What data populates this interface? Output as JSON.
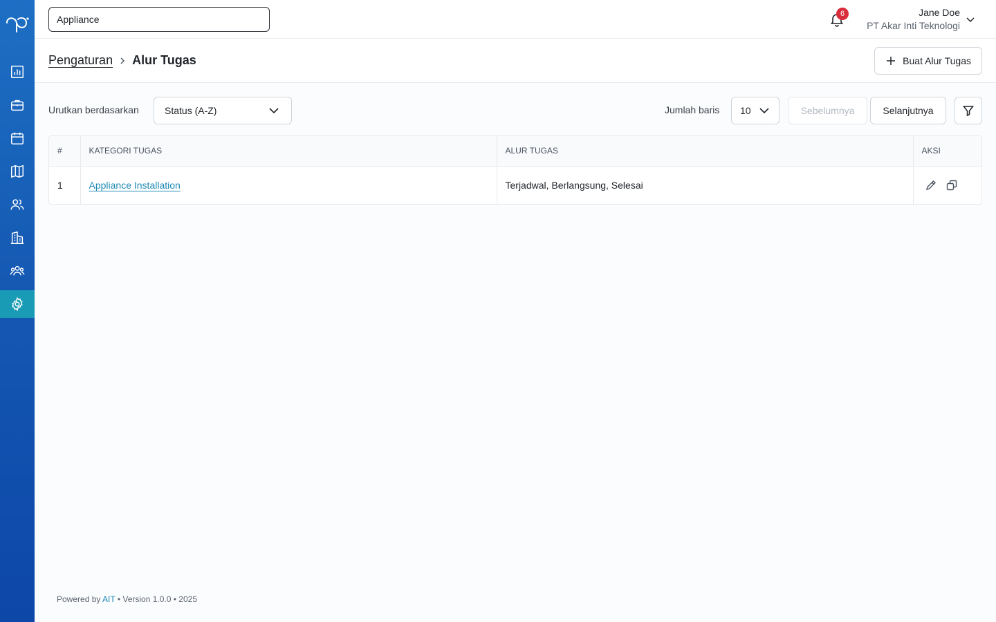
{
  "search": {
    "value": "Appliance"
  },
  "sidebar": {
    "items": [
      {
        "icon": "chart-bar-icon",
        "name": "sidebar-item-dashboard",
        "active": false
      },
      {
        "icon": "briefcase-icon",
        "name": "sidebar-item-jobs",
        "active": false
      },
      {
        "icon": "calendar-icon",
        "name": "sidebar-item-schedule",
        "active": false
      },
      {
        "icon": "map-icon",
        "name": "sidebar-item-map",
        "active": false
      },
      {
        "icon": "users-icon",
        "name": "sidebar-item-users",
        "active": false
      },
      {
        "icon": "building-icon",
        "name": "sidebar-item-companies",
        "active": false
      },
      {
        "icon": "team-icon",
        "name": "sidebar-item-teams",
        "active": false
      },
      {
        "icon": "gear-icon",
        "name": "sidebar-item-settings",
        "active": true
      }
    ]
  },
  "header": {
    "notification_count": "6",
    "user_name": "Jane Doe",
    "user_org": "PT Akar Inti Teknologi"
  },
  "breadcrumb": {
    "parent": "Pengaturan",
    "current": "Alur Tugas"
  },
  "actions": {
    "create_label": "Buat Alur Tugas"
  },
  "toolbar": {
    "sort_label": "Urutkan berdasarkan",
    "sort_value": "Status (A-Z)",
    "rows_label": "Jumlah baris",
    "rows_value": "10",
    "prev_label": "Sebelumnya",
    "next_label": "Selanjutnya"
  },
  "table": {
    "columns": [
      "#",
      "KATEGORI TUGAS",
      "ALUR TUGAS",
      "AKSI"
    ],
    "rows": [
      {
        "no": "1",
        "category": "Appliance Installation",
        "workflow": "Terjadwal, Berlangsung, Selesai"
      }
    ]
  },
  "footer": {
    "prefix": "Powered by",
    "brand": "AIT",
    "suffix": "• Version 1.0.0 • 2025"
  },
  "colors": {
    "sidebar": "#1559b3",
    "sidebar_active": "#1a9bb5",
    "link": "#1e8ab5",
    "badge": "#d92c3a"
  }
}
